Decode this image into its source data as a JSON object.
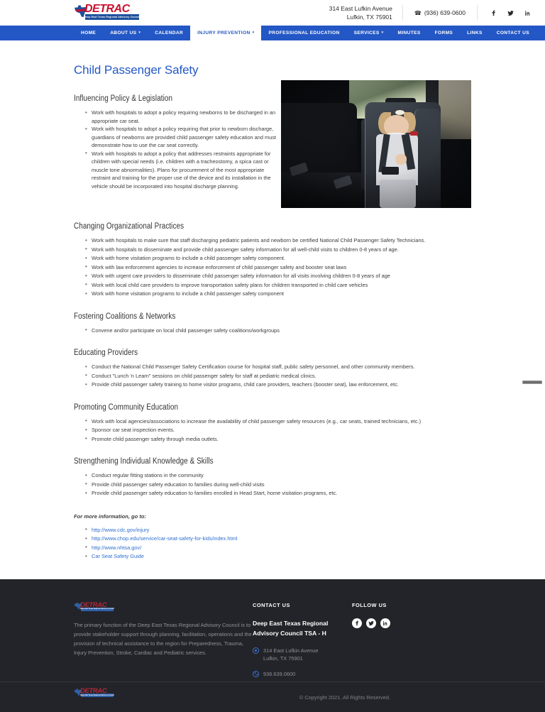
{
  "header": {
    "logo": {
      "word": "DETRAC",
      "tagline": "Deep East Texas Regional Advisory Council"
    },
    "address_line1": "314 East Lufkin Avenue",
    "address_line2": "Lufkin, TX 75901",
    "phone": "(936) 639-0600",
    "socials": [
      "facebook-icon",
      "twitter-icon",
      "linkedin-icon"
    ]
  },
  "nav": {
    "items": [
      {
        "label": "HOME",
        "caret": false,
        "active": false
      },
      {
        "label": "ABOUT US",
        "caret": true,
        "active": false
      },
      {
        "label": "CALENDAR",
        "caret": false,
        "active": false
      },
      {
        "label": "INJURY PREVENTION",
        "caret": true,
        "active": true
      },
      {
        "label": "PROFESSIONAL EDUCATION",
        "caret": false,
        "active": false
      },
      {
        "label": "SERVICES",
        "caret": true,
        "active": false
      },
      {
        "label": "MINUTES",
        "caret": false,
        "active": false
      },
      {
        "label": "FORMS",
        "caret": false,
        "active": false
      },
      {
        "label": "LINKS",
        "caret": false,
        "active": false
      },
      {
        "label": "CONTACT US",
        "caret": false,
        "active": false
      }
    ],
    "caret_glyph": "▾",
    "bar_color": "#2357c5",
    "active_text_color": "#2357c5"
  },
  "main": {
    "title": "Child Passenger Safety",
    "title_color": "#2357c5",
    "photo_alt": "toddler-buckled-in-rear-facing-car-seat",
    "sections": [
      {
        "heading": "Influencing Policy & Legislation",
        "bullets": [
          "Work with hospitals to adopt a policy requiring newborns to be discharged in an appropriate car seat.",
          "Work with hospitals to adopt a policy requiring that prior to newborn discharge, guardians of newborns are provided child passenger safety education and must demonstrate how to use the car seat correctly.",
          "Work with hospitals to adopt a policy that addresses restraints appropriate for children with special needs (i.e. children with a tracheostomy, a spica cast or muscle tone abnormalities). Plans for procurement of the most appropriate restraint and training for the proper use of the device and its installation in the vehicle should be incorporated into hospital discharge planning."
        ]
      },
      {
        "heading": "Changing Organizational Practices",
        "bullets": [
          "Work with hospitals to make sure that staff discharging pediatric patients and newborn be certified National Child Passenger Safety Technicians.",
          "Work with hospitals to disseminate and provide child passenger safety information for all well-child visits to children 0-8 years of age.",
          "Work with home visitation programs to include a child passenger safety component.",
          "Work with law enforcement agencies to increase enforcement of child passenger safety and booster seat laws",
          "Work with urgent care providers to disseminate child passenger safety information for all visits involving children 0-8 years of age",
          "Work with local child care providers to improve transportation safety plans for children transported in child care vehicles",
          "Work with home visitation programs to include a child passenger safety component"
        ]
      },
      {
        "heading": "Fostering Coalitions & Networks",
        "bullets": [
          "Convene and/or participate on local child passenger safety coalitions/workgroups"
        ]
      },
      {
        "heading": "Educating Providers",
        "bullets": [
          "Conduct the National Child Passenger Safety Certification course for hospital staff, public safety personnel, and other community members.",
          "Conduct \"Lunch 'n Learn\" sessions on child passenger safety for staff at pediatric medical clinics.",
          "Provide child passenger safety training to home visitor programs, child care providers, teachers (booster seat), law enforcement, etc."
        ]
      },
      {
        "heading": "Promoting Community Education",
        "bullets": [
          "Work with local agencies/associations to increase the availability of child passenger safety resources (e.g., car seats, trained technicians, etc.)",
          "Sponsor car seat inspection events.",
          "Promote child passenger safety through media outlets."
        ]
      },
      {
        "heading": "Strengthening Individual Knowledge & Skills",
        "bullets": [
          "Conduct regular fitting stations in the community",
          "Provide child passenger safety education to families during well-child visits",
          "Provide child passenger safety education to families enrolled in Head Start, home visitation programs, etc."
        ]
      }
    ],
    "more_info_label": "For more information, go to:",
    "links": [
      "http://www.cdc.gov/injury",
      "http://www.chop.edu/service/car-seat-safety-for-kids/index.html",
      "http://www.nhtsa.gov/",
      "Car Seat Safety Guide"
    ],
    "link_color": "#2f6fd0"
  },
  "footer": {
    "logo": {
      "word": "DETRAC",
      "tagline": "Deep East Texas Regional Advisory Council"
    },
    "about": "The primary function of the Deep East Texas Regional Advisory Council is to provide stakeholder support through planning, facilitation, operations and the provision of technical assistance to the region for Preparedness, Trauma, Injury Prevention, Stroke, Cardiac and Pediatric services.",
    "contact_heading": "CONTACT US",
    "org_name": "Deep East Texas Regional Advisory Council TSA - H",
    "address_line1": "314 East Lufkin Avenue",
    "address_line2": "Lufkin, TX 75901",
    "phone": "936.639.0600",
    "follow_heading": "FOLLOW US",
    "socials": [
      "facebook-icon",
      "twitter-icon",
      "linkedin-icon"
    ],
    "copyright": "© Copyright 2021. All Rights Reserved.",
    "bg_color": "#232429"
  }
}
